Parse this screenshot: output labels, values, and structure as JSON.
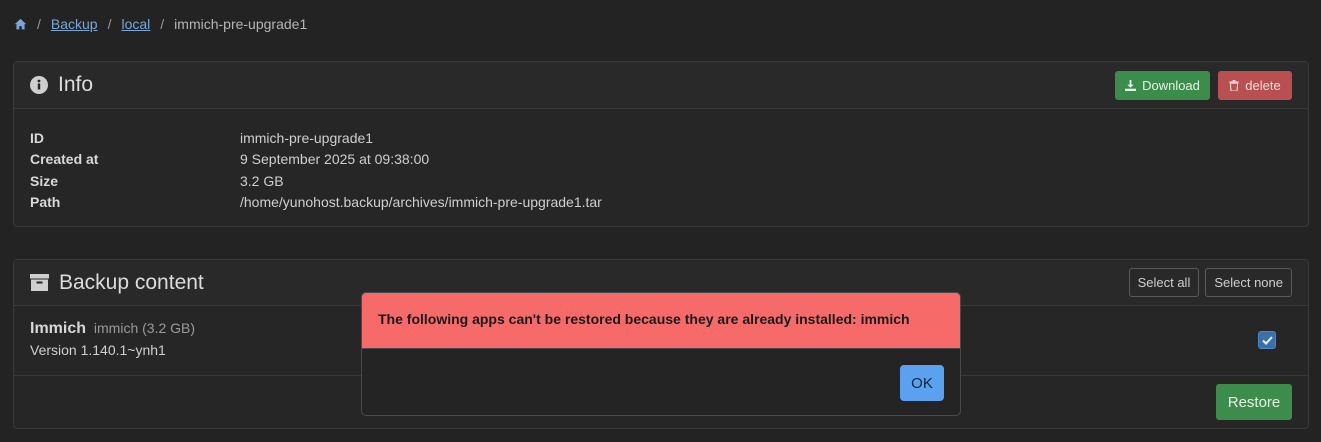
{
  "breadcrumb": {
    "items": [
      "Backup",
      "local"
    ],
    "current": "immich-pre-upgrade1"
  },
  "info": {
    "title": "Info",
    "download_label": "Download",
    "delete_label": "delete",
    "rows": [
      {
        "key": "ID",
        "value": "immich-pre-upgrade1"
      },
      {
        "key": "Created at",
        "value": "9 September 2025 at 09:38:00"
      },
      {
        "key": "Size",
        "value": "3.2 GB"
      },
      {
        "key": "Path",
        "value": "/home/yunohost.backup/archives/immich-pre-upgrade1.tar"
      }
    ]
  },
  "content": {
    "title": "Backup content",
    "select_all_label": "Select all",
    "select_none_label": "Select none",
    "app": {
      "name": "Immich",
      "id_size": "immich (3.2 GB)",
      "version": "Version 1.140.1~ynh1",
      "checked": true
    },
    "restore_label": "Restore"
  },
  "modal": {
    "message": "The following apps can't be restored because they are already installed: immich",
    "ok_label": "OK"
  },
  "colors": {
    "success": "#3c8c4c",
    "danger": "#b84f51",
    "alert": "#f66a6a",
    "primary": "#5aa2f0"
  }
}
